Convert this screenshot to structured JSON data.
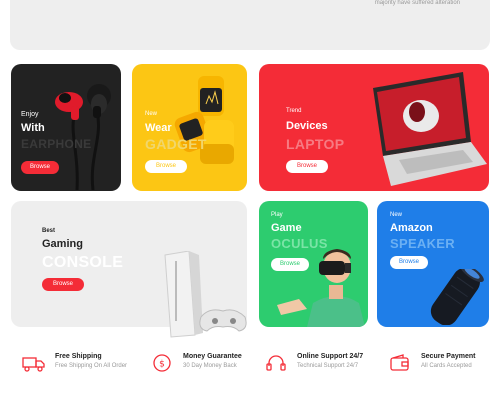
{
  "hero": {
    "caption": "majority have suffered alteration"
  },
  "cards": {
    "earphone": {
      "eyebrow": "Enjoy",
      "main": "With",
      "big": "EARPHONE",
      "button": "Browse",
      "color": "#222222"
    },
    "watch": {
      "eyebrow": "New",
      "main": "Wear",
      "big": "GADGET",
      "button": "Browse",
      "color": "#fcc614"
    },
    "laptop": {
      "eyebrow": "Trend",
      "main": "Devices",
      "big": "LAPTOP",
      "button": "Browse",
      "color": "#f42c37"
    },
    "console": {
      "eyebrow": "Best",
      "main": "Gaming",
      "big": "CONSOLE",
      "button": "Browse",
      "color": "#eeeeee"
    },
    "oculus": {
      "eyebrow": "Play",
      "main": "Game",
      "big": "OCULUS",
      "button": "Browse",
      "color": "#2dcc6f"
    },
    "speaker": {
      "eyebrow": "New",
      "main": "Amazon",
      "big": "SPEAKER",
      "button": "Browse",
      "color": "#1f7ee8"
    }
  },
  "features": [
    {
      "icon": "truck-icon",
      "title": "Free Shipping",
      "subtitle": "Free Shipping On All Order"
    },
    {
      "icon": "money-back-icon",
      "title": "Money Guarantee",
      "subtitle": "30 Day Money Back"
    },
    {
      "icon": "headphones-icon",
      "title": "Online Support 24/7",
      "subtitle": "Technical Support 24/7"
    },
    {
      "icon": "wallet-icon",
      "title": "Secure Payment",
      "subtitle": "All Cards Accepted"
    }
  ],
  "colors": {
    "accent": "#f42c37",
    "muted_text": "#9a9a9a"
  }
}
